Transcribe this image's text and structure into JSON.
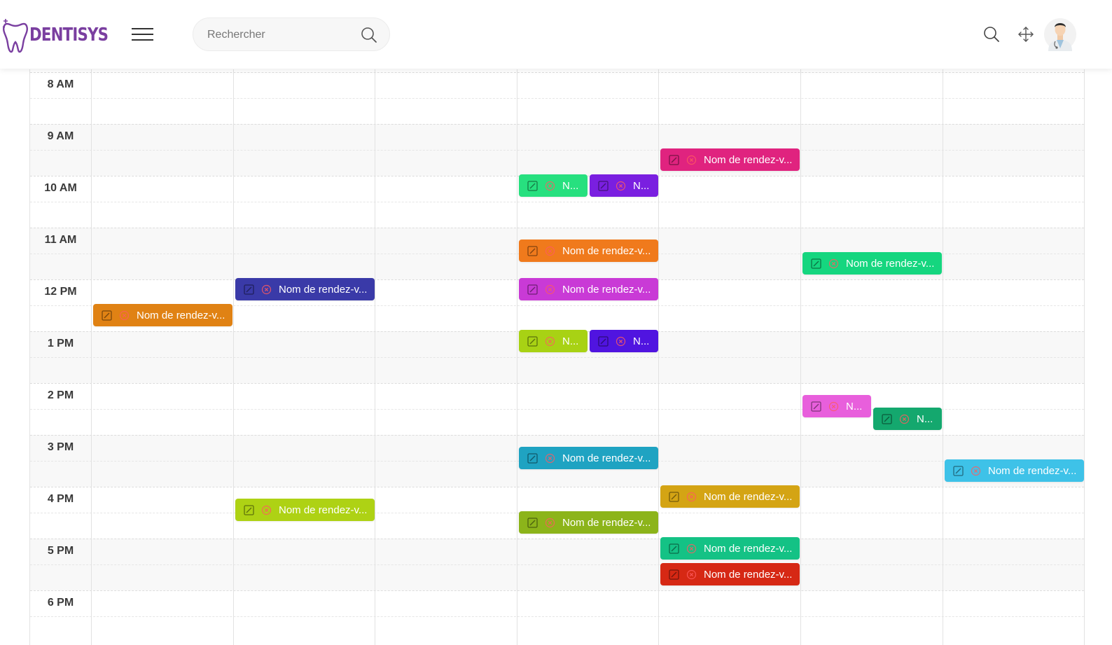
{
  "app": {
    "name": "DENTISYS"
  },
  "header": {
    "search": {
      "placeholder": "Rechercher",
      "value": ""
    },
    "icons": [
      "menu-icon",
      "search-icon",
      "fullscreen-icon",
      "doctor-avatar"
    ]
  },
  "calendar": {
    "times": [
      "8 AM",
      "9 AM",
      "10 AM",
      "11 AM",
      "12 PM",
      "1 PM",
      "2 PM",
      "3 PM",
      "4 PM",
      "5 PM",
      "6 PM"
    ],
    "events": [
      {
        "title": "Nom de rendez-v...",
        "color": "#e0237f",
        "day": 4,
        "start": "9:30",
        "lane": 0,
        "lanes": 1
      },
      {
        "title": "N...",
        "color": "#27e07f",
        "day": 3,
        "start": "10:00",
        "lane": 0,
        "lanes": 2
      },
      {
        "title": "N...",
        "color": "#7a1fe0",
        "day": 3,
        "start": "10:00",
        "lane": 1,
        "lanes": 2
      },
      {
        "title": "Nom de rendez-v...",
        "color": "#f07a1c",
        "day": 3,
        "start": "11:15",
        "lane": 0,
        "lanes": 1
      },
      {
        "title": "Nom de rendez-v...",
        "color": "#15d67f",
        "day": 5,
        "start": "11:30",
        "lane": 0,
        "lanes": 1
      },
      {
        "title": "Nom de rendez-v...",
        "color": "#3a3aa8",
        "day": 1,
        "start": "12:00",
        "lane": 0,
        "lanes": 1
      },
      {
        "title": "Nom de rendez-v...",
        "color": "#c93ad6",
        "day": 3,
        "start": "12:00",
        "lane": 0,
        "lanes": 1
      },
      {
        "title": "Nom de rendez-v...",
        "color": "#e08214",
        "day": 0,
        "start": "12:30",
        "lane": 0,
        "lanes": 1
      },
      {
        "title": "N...",
        "color": "#a8d214",
        "day": 3,
        "start": "13:00",
        "lane": 0,
        "lanes": 2
      },
      {
        "title": "N...",
        "color": "#5014e0",
        "day": 3,
        "start": "13:00",
        "lane": 1,
        "lanes": 2
      },
      {
        "title": "N...",
        "color": "#e85fdc",
        "day": 5,
        "start": "14:15",
        "lane": 0,
        "lanes": 2
      },
      {
        "title": "N...",
        "color": "#14a86e",
        "day": 5,
        "start": "14:30",
        "lane": 1,
        "lanes": 2
      },
      {
        "title": "Nom de rendez-v...",
        "color": "#1fa3c2",
        "day": 3,
        "start": "15:15",
        "lane": 0,
        "lanes": 1
      },
      {
        "title": "Nom de rendez-v...",
        "color": "#3ec2e8",
        "day": 6,
        "start": "15:30",
        "lane": 0,
        "lanes": 1
      },
      {
        "title": "Nom de rendez-v...",
        "color": "#d4a414",
        "day": 4,
        "start": "16:00",
        "lane": 0,
        "lanes": 1
      },
      {
        "title": "Nom de rendez-v...",
        "color": "#aed214",
        "day": 1,
        "start": "16:15",
        "lane": 0,
        "lanes": 1
      },
      {
        "title": "Nom de rendez-v...",
        "color": "#8cb41a",
        "day": 3,
        "start": "16:30",
        "lane": 0,
        "lanes": 1
      },
      {
        "title": "Nom de rendez-v...",
        "color": "#14c285",
        "day": 4,
        "start": "17:00",
        "lane": 0,
        "lanes": 1
      },
      {
        "title": "Nom de rendez-v...",
        "color": "#d62814",
        "day": 4,
        "start": "17:30",
        "lane": 0,
        "lanes": 1
      }
    ]
  }
}
